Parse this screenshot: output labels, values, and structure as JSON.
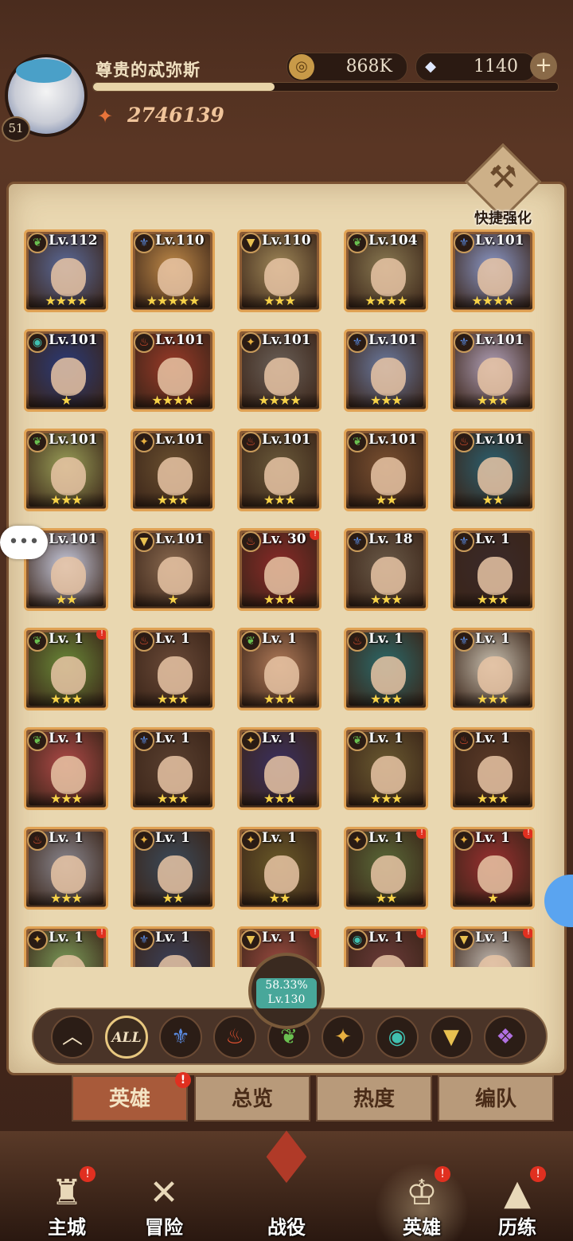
{
  "header": {
    "player_name": "尊贵的忒弥斯",
    "player_level": "51",
    "xp_fraction": 0.39,
    "power": "2746139",
    "gold": "868K",
    "diamonds": "1140"
  },
  "quick_enhance": {
    "label": "快捷强化"
  },
  "heroes": [
    {
      "level": "Lv.112",
      "stars": "★★★★",
      "faction": "nature",
      "color": "#5a6a9a",
      "alert": false
    },
    {
      "level": "Lv.110",
      "stars": "★★★★★",
      "faction": "water",
      "color": "#c08a48",
      "alert": false
    },
    {
      "level": "Lv.110",
      "stars": "★★★",
      "faction": "light",
      "color": "#a08858",
      "alert": false
    },
    {
      "level": "Lv.104",
      "stars": "★★★★",
      "faction": "nature",
      "color": "#8a7a52",
      "alert": false
    },
    {
      "level": "Lv.101",
      "stars": "★★★★",
      "faction": "water",
      "color": "#8a98c8",
      "alert": false
    },
    {
      "level": "Lv.101",
      "stars": "★",
      "faction": "eye",
      "color": "#2a3a78",
      "alert": false
    },
    {
      "level": "Lv.101",
      "stars": "★★★★",
      "faction": "fire",
      "color": "#9a3a28",
      "alert": false
    },
    {
      "level": "Lv.101",
      "stars": "★★★★",
      "faction": "sun",
      "color": "#6a6058",
      "alert": false
    },
    {
      "level": "Lv.101",
      "stars": "★★★",
      "faction": "water",
      "color": "#6a7aa0",
      "alert": false
    },
    {
      "level": "Lv.101",
      "stars": "★★★",
      "faction": "water",
      "color": "#b0a0b8",
      "alert": false
    },
    {
      "level": "Lv.101",
      "stars": "★★★",
      "faction": "nature",
      "color": "#9aa058",
      "alert": false
    },
    {
      "level": "Lv.101",
      "stars": "★★★",
      "faction": "sun",
      "color": "#6a5030",
      "alert": false
    },
    {
      "level": "Lv.101",
      "stars": "★★★",
      "faction": "fire",
      "color": "#6a5a3a",
      "alert": false
    },
    {
      "level": "Lv.101",
      "stars": "★★",
      "faction": "nature",
      "color": "#7a5030",
      "alert": false
    },
    {
      "level": "Lv.101",
      "stars": "★★",
      "faction": "fire",
      "color": "#2a6070",
      "alert": false
    },
    {
      "level": "Lv.101",
      "stars": "★★",
      "faction": "water",
      "color": "#c8cce0",
      "alert": false
    },
    {
      "level": "Lv.101",
      "stars": "★",
      "faction": "light",
      "color": "#8a6a50",
      "alert": false
    },
    {
      "level": "Lv. 30",
      "stars": "★★★",
      "faction": "fire",
      "color": "#8a2a28",
      "alert": true
    },
    {
      "level": "Lv. 18",
      "stars": "★★★",
      "faction": "water",
      "color": "#6a5a48",
      "alert": false
    },
    {
      "level": "Lv. 1",
      "stars": "★★★",
      "faction": "water",
      "color": "#3a2a2a",
      "alert": false
    },
    {
      "level": "Lv. 1",
      "stars": "★★★",
      "faction": "nature",
      "color": "#6a8a38",
      "alert": true
    },
    {
      "level": "Lv. 1",
      "stars": "★★★",
      "faction": "fire",
      "color": "#6a4a38",
      "alert": false
    },
    {
      "level": "Lv. 1",
      "stars": "★★★",
      "faction": "nature",
      "color": "#b07a58",
      "alert": false
    },
    {
      "level": "Lv. 1",
      "stars": "★★★",
      "faction": "fire",
      "color": "#2a6a6a",
      "alert": false
    },
    {
      "level": "Lv. 1",
      "stars": "★★★",
      "faction": "water",
      "color": "#c8c0b0",
      "alert": false
    },
    {
      "level": "Lv. 1",
      "stars": "★★★",
      "faction": "nature",
      "color": "#b04a48",
      "alert": false
    },
    {
      "level": "Lv. 1",
      "stars": "★★★",
      "faction": "water",
      "color": "#5a4030",
      "alert": false
    },
    {
      "level": "Lv. 1",
      "stars": "★★★",
      "faction": "sun",
      "color": "#3a3060",
      "alert": false
    },
    {
      "level": "Lv. 1",
      "stars": "★★★",
      "faction": "nature",
      "color": "#6a5a30",
      "alert": false
    },
    {
      "level": "Lv. 1",
      "stars": "★★★",
      "faction": "fire",
      "color": "#5a3a28",
      "alert": false
    },
    {
      "level": "Lv. 1",
      "stars": "★★★",
      "faction": "fire",
      "color": "#8a8890",
      "alert": false
    },
    {
      "level": "Lv. 1",
      "stars": "★★",
      "faction": "sun",
      "color": "#3a4a5a",
      "alert": false
    },
    {
      "level": "Lv. 1",
      "stars": "★★",
      "faction": "sun",
      "color": "#6a5a28",
      "alert": false
    },
    {
      "level": "Lv. 1",
      "stars": "★★",
      "faction": "sun",
      "color": "#5a6a38",
      "alert": true
    },
    {
      "level": "Lv. 1",
      "stars": "★",
      "faction": "sun",
      "color": "#9a3030",
      "alert": true
    },
    {
      "level": "Lv. 1",
      "stars": "",
      "faction": "sun",
      "color": "#7a9a58",
      "alert": true
    },
    {
      "level": "Lv. 1",
      "stars": "",
      "faction": "water",
      "color": "#3a4058",
      "alert": false
    },
    {
      "level": "Lv. 1",
      "stars": "",
      "faction": "light",
      "color": "#9a4a40",
      "alert": true
    },
    {
      "level": "Lv. 1",
      "stars": "",
      "faction": "eye",
      "color": "#6a3a38",
      "alert": true
    },
    {
      "level": "Lv. 1",
      "stars": "",
      "faction": "light",
      "color": "#c0b8b0",
      "alert": true
    }
  ],
  "progress": {
    "percent": "58.33%",
    "level": "Lv.130"
  },
  "filters": [
    {
      "id": "collapse",
      "glyph": "︿",
      "color": "#f0e0c0"
    },
    {
      "id": "all",
      "glyph": "ALL",
      "color": "#f0e0c0"
    },
    {
      "id": "water",
      "glyph": "⚜",
      "color": "#5a8ae0"
    },
    {
      "id": "fire",
      "glyph": "♨",
      "color": "#e05030"
    },
    {
      "id": "nature",
      "glyph": "❦",
      "color": "#6ac050"
    },
    {
      "id": "sun",
      "glyph": "✦",
      "color": "#e8b040"
    },
    {
      "id": "eye",
      "glyph": "◉",
      "color": "#40c0b0"
    },
    {
      "id": "light",
      "glyph": "▼",
      "color": "#e8c050"
    },
    {
      "id": "dark",
      "glyph": "❖",
      "color": "#b070e0"
    }
  ],
  "tabs": [
    {
      "label": "英雄",
      "active": true,
      "alert": true
    },
    {
      "label": "总览",
      "active": false,
      "alert": false
    },
    {
      "label": "热度",
      "active": false,
      "alert": false
    },
    {
      "label": "编队",
      "active": false,
      "alert": false
    }
  ],
  "nav": {
    "main_city": "主城",
    "adventure": "冒险",
    "campaign": "战役",
    "heroes": "英雄",
    "trials": "历练"
  },
  "colors": {
    "accent": "#e0a254",
    "alert": "#e03020",
    "board": "#e9d7b0"
  }
}
